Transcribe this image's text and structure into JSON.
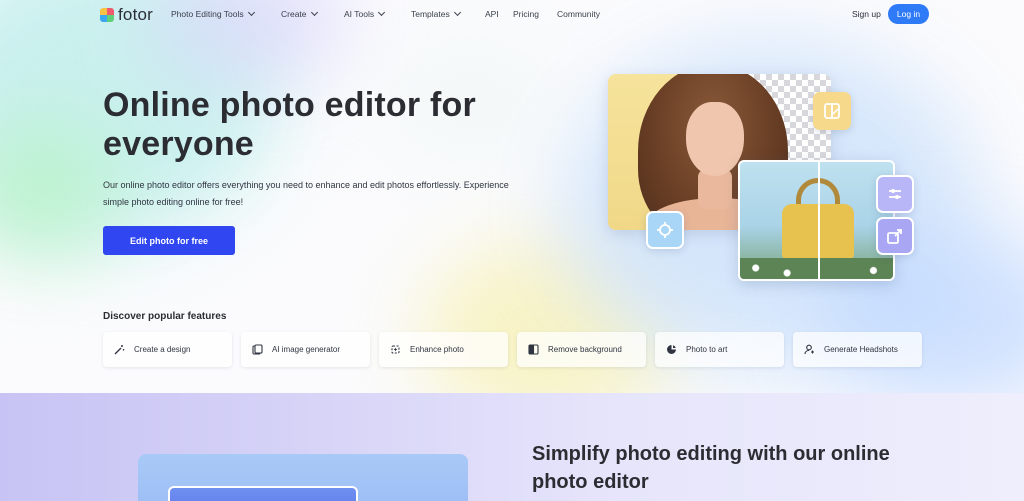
{
  "nav": {
    "logo": "fotor",
    "items": [
      {
        "label": "Photo Editing Tools",
        "dropdown": true
      },
      {
        "label": "Create",
        "dropdown": true
      },
      {
        "label": "AI Tools",
        "dropdown": true
      },
      {
        "label": "Templates",
        "dropdown": true
      },
      {
        "label": "API",
        "dropdown": false
      },
      {
        "label": "Pricing",
        "dropdown": false
      },
      {
        "label": "Community",
        "dropdown": false
      }
    ],
    "signup": "Sign up",
    "login": "Log in"
  },
  "hero": {
    "title": "Online photo editor for everyone",
    "description": "Our online photo editor offers everything you need to enhance and edit photos effortlessly. Experience simple photo editing online for free!",
    "cta": "Edit photo for free"
  },
  "features": {
    "title": "Discover popular features",
    "items": [
      {
        "label": "Create a design",
        "icon": "magic-wand-icon"
      },
      {
        "label": "AI image generator",
        "icon": "ai-image-icon"
      },
      {
        "label": "Enhance photo",
        "icon": "sparkle-icon"
      },
      {
        "label": "Remove background",
        "icon": "remove-bg-icon"
      },
      {
        "label": "Photo to art",
        "icon": "art-icon"
      },
      {
        "label": "Generate Headshots",
        "icon": "headshot-icon"
      }
    ]
  },
  "section2": {
    "title": "Simplify photo editing with our online photo editor"
  },
  "colors": {
    "primary": "#2f46f0",
    "login": "#2f7af7"
  }
}
